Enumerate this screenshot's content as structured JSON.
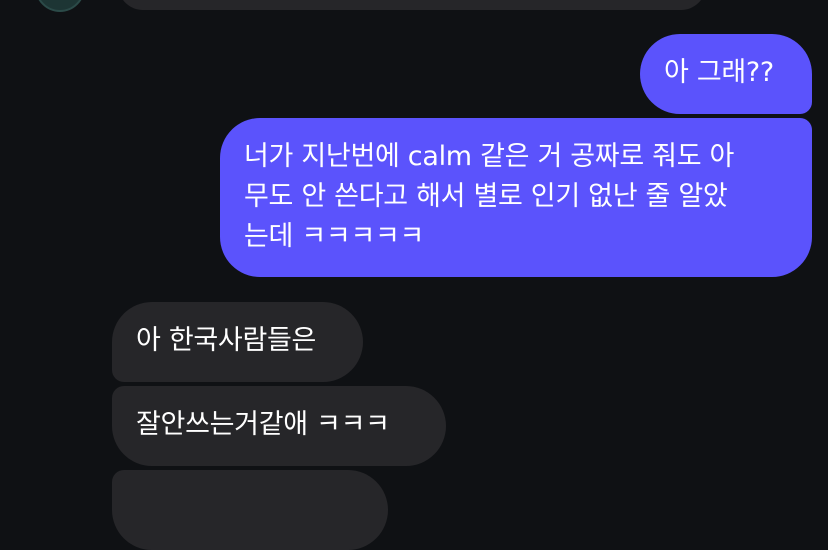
{
  "conversation": {
    "messages": [
      {
        "sender": "other",
        "text": ""
      },
      {
        "sender": "me",
        "text": "아 그래??"
      },
      {
        "sender": "me",
        "lines": [
          "너가 지난번에 calm 같은 거 공짜로 줘도 아",
          "무도 안 쓴다고 해서 별로 인기 없난 줄 알았",
          "는데 ㅋㅋㅋㅋㅋ"
        ]
      },
      {
        "sender": "other",
        "text": "아 한국사람들은"
      },
      {
        "sender": "other",
        "text": "잘안쓰는거같애 ㅋㅋㅋ"
      },
      {
        "sender": "other",
        "text": ""
      }
    ]
  },
  "colors": {
    "background": "#0f1114",
    "outgoing_bubble": "#5b53fc",
    "incoming_bubble": "#262629",
    "text": "#ffffff"
  },
  "icons": {
    "avatar": "user-avatar"
  }
}
